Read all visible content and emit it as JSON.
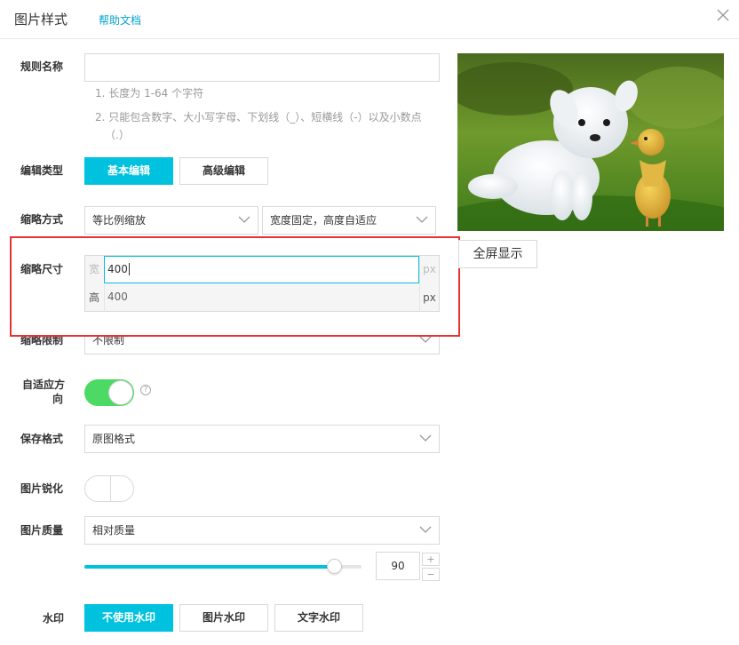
{
  "header": {
    "title": "图片样式",
    "help_link": "帮助文档"
  },
  "rule_name": {
    "label": "规则名称",
    "value": "",
    "hints": [
      "1. 长度为 1-64 个字符",
      "2. 只能包含数字、大小写字母、下划线（_）、短横线（-）以及小数点",
      "（.）"
    ]
  },
  "edit_type": {
    "label": "编辑类型",
    "options": [
      "基本编辑",
      "高级编辑"
    ],
    "selected": "基本编辑"
  },
  "resize_mode": {
    "label": "缩略方式",
    "method": "等比例缩放",
    "constraint": "宽度固定，高度自适应"
  },
  "resize_size": {
    "label": "缩略尺寸",
    "width_prefix": "宽",
    "width_value": "400",
    "height_prefix": "高",
    "height_value": "400",
    "unit": "px"
  },
  "resize_limit": {
    "label": "缩略限制",
    "value": "不限制"
  },
  "auto_orient": {
    "label_line1": "自适应方",
    "label_line2": "向",
    "enabled": true,
    "help_glyph": "?"
  },
  "save_format": {
    "label": "保存格式",
    "value": "原图格式"
  },
  "sharpen": {
    "label": "图片锐化",
    "enabled": false
  },
  "quality": {
    "label": "图片质量",
    "mode": "相对质量",
    "value": "90",
    "slider_fraction": 0.9,
    "plus": "+",
    "minus": "−"
  },
  "watermark": {
    "label": "水印",
    "options": [
      "不使用水印",
      "图片水印",
      "文字水印"
    ],
    "selected": "不使用水印"
  },
  "preview": {
    "fullscreen_label": "全屏显示"
  },
  "colors": {
    "accent": "#00c1de",
    "link": "#00a2ca",
    "toggle_on": "#4cd964",
    "highlight": "#e53333"
  }
}
